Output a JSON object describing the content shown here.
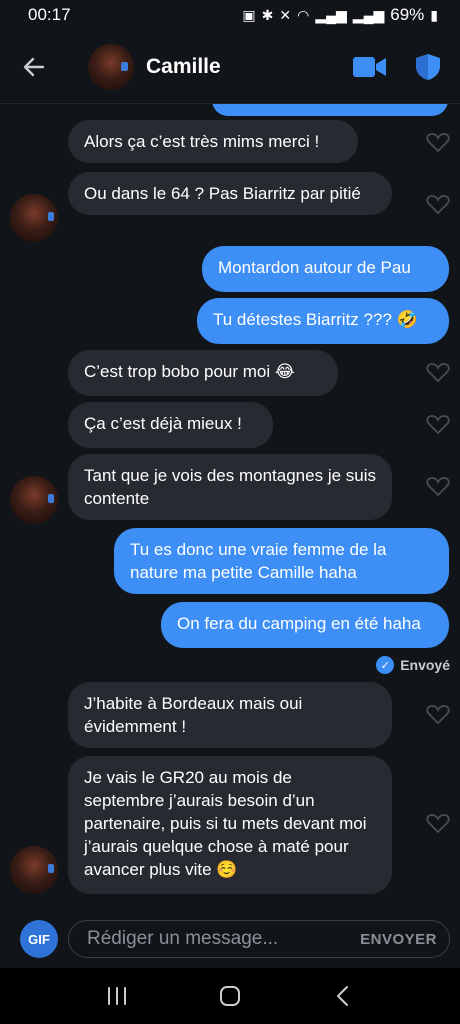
{
  "status_bar": {
    "time": "00:17",
    "battery": "69%"
  },
  "header": {
    "contact_name": "Camille"
  },
  "messages": [
    {
      "direction": "in",
      "text": "Alors ça c’est très mims merci !"
    },
    {
      "direction": "in",
      "text": "Ou dans le 64 ? Pas Biarritz par pitié"
    },
    {
      "direction": "out",
      "text": "Montardon autour de Pau"
    },
    {
      "direction": "out",
      "text": "Tu détestes Biarritz ??? 🤣"
    },
    {
      "direction": "in",
      "text": "C’est trop bobo pour moi 😂"
    },
    {
      "direction": "in",
      "text": "Ça c’est déjà mieux !"
    },
    {
      "direction": "in",
      "text": "Tant que je vois des montagnes je suis contente"
    },
    {
      "direction": "out",
      "text": "Tu es donc une vraie femme de la nature ma petite Camille haha"
    },
    {
      "direction": "out",
      "text": "On fera du camping en été haha"
    },
    {
      "direction": "in",
      "text": "J’habite à Bordeaux mais oui évidemment !"
    },
    {
      "direction": "in",
      "text": "Je vais le GR20 au mois de septembre j’aurais besoin d’un partenaire, puis si tu mets devant moi j’aurais quelque chose à maté pour avancer plus vite ☺️"
    }
  ],
  "sent_status": "Envoyé",
  "composer": {
    "gif_label": "GIF",
    "placeholder": "Rédiger un message...",
    "send_label": "ENVOYER"
  },
  "colors": {
    "background": "#111418",
    "incoming_bubble": "#272b31",
    "outgoing_bubble": "#3d8ef5",
    "accent": "#2f73d8"
  },
  "icons": {
    "back": "arrow-left-icon",
    "video": "video-camera-icon",
    "safety": "shield-icon",
    "like": "heart-outline-icon"
  }
}
